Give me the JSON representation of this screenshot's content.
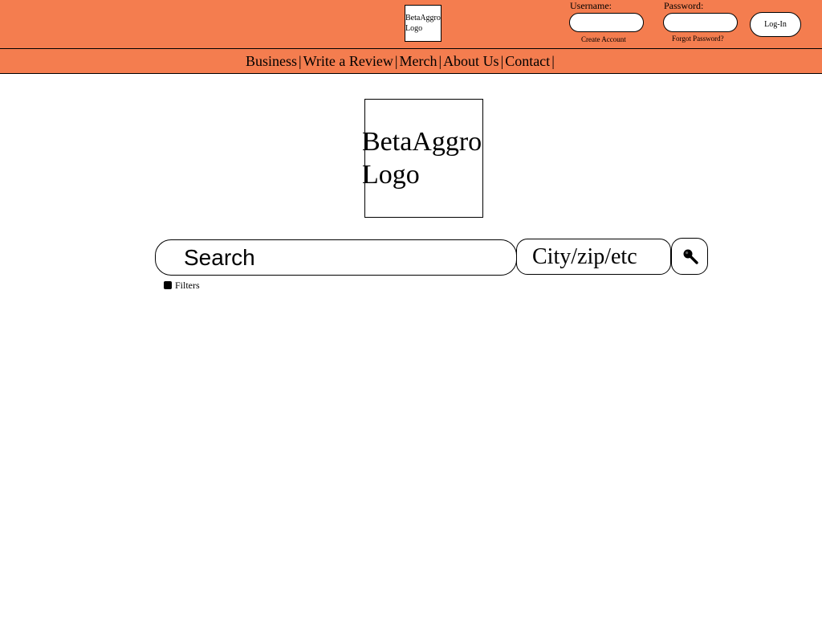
{
  "header": {
    "small_logo": "BetaAggro Logo",
    "username_label": "Username:",
    "password_label": "Password:",
    "username_value": "",
    "password_value": "",
    "create_account": "Create Account",
    "forgot_password": "Forgot Password?",
    "login_button": "Log-In",
    "background_color": "#f47d4f"
  },
  "nav": {
    "items": [
      "Business",
      "Write a Review",
      "Merch",
      "About Us",
      "Contact"
    ],
    "separator": "|"
  },
  "main": {
    "logo_line1": "BetaAggro",
    "logo_line2": "Logo",
    "search_placeholder": "Search",
    "location_placeholder": "City/zip/etc",
    "search_button_icon": "magnifier-icon",
    "filters_label": "Filters"
  }
}
